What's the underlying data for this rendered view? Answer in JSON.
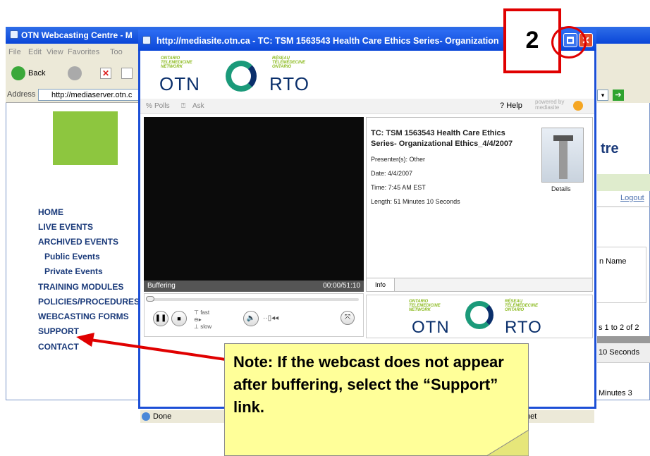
{
  "bg_window": {
    "title": "OTN Webcasting Centre - M",
    "menu": [
      "File",
      "Edit",
      "View",
      "Favorites",
      "Too"
    ],
    "back_label": "Back",
    "address_label": "Address",
    "address_value": "http://mediaserver.otn.c",
    "heading_partial": "tre",
    "logout": "Logout",
    "name_col": "n Name",
    "results": "s 1 to 2 of 2",
    "row1": "10 Seconds",
    "row2": "Minutes 3",
    "nav": [
      "HOME",
      "LIVE EVENTS",
      "ARCHIVED EVENTS",
      "Public Events",
      "Private Events",
      "TRAINING MODULES",
      "POLICIES/PROCEDURES",
      "WEBCASTING FORMS",
      "SUPPORT",
      "CONTACT"
    ]
  },
  "popup": {
    "title": "http://mediasite.otn.ca - TC: TSM 1563543 Health Care Ethics Series- Organization",
    "logo_left_lines": [
      "ONTARIO",
      "TELEMEDICINE",
      "NETWORK"
    ],
    "logo_right_lines": [
      "RÉSEAU",
      "TÉLÉMÉDECINE",
      "ONTARIO"
    ],
    "logo_otn": "OTN",
    "logo_rto": "RTO",
    "polls": "Polls",
    "ask": "Ask",
    "help": "Help",
    "powered": "powered by",
    "mediasite": "mediasite",
    "buffering": "Buffering",
    "time": "00:00/51:10",
    "fast": "fast",
    "slow": "slow",
    "info_title_1": "TC: TSM 1563543 Health Care Ethics",
    "info_title_2": "Series- Organizational Ethics_4/4/2007",
    "presenter": "Presenter(s): Other",
    "date": "Date: 4/4/2007",
    "time_est": "Time: 7:45 AM EST",
    "length": "Length: 51 Minutes 10 Seconds",
    "details": "Details",
    "info_tab": "Info",
    "status": "Done",
    "status_right": "net"
  },
  "annotation": {
    "step": "2",
    "note": "Note: If the webcast does not appear after buffering, select the “Support” link."
  },
  "colors": {
    "xp_blue": "#0b47d8",
    "red": "#e00000",
    "note_yellow": "#ffff99",
    "nav_blue": "#1a3a7a"
  }
}
